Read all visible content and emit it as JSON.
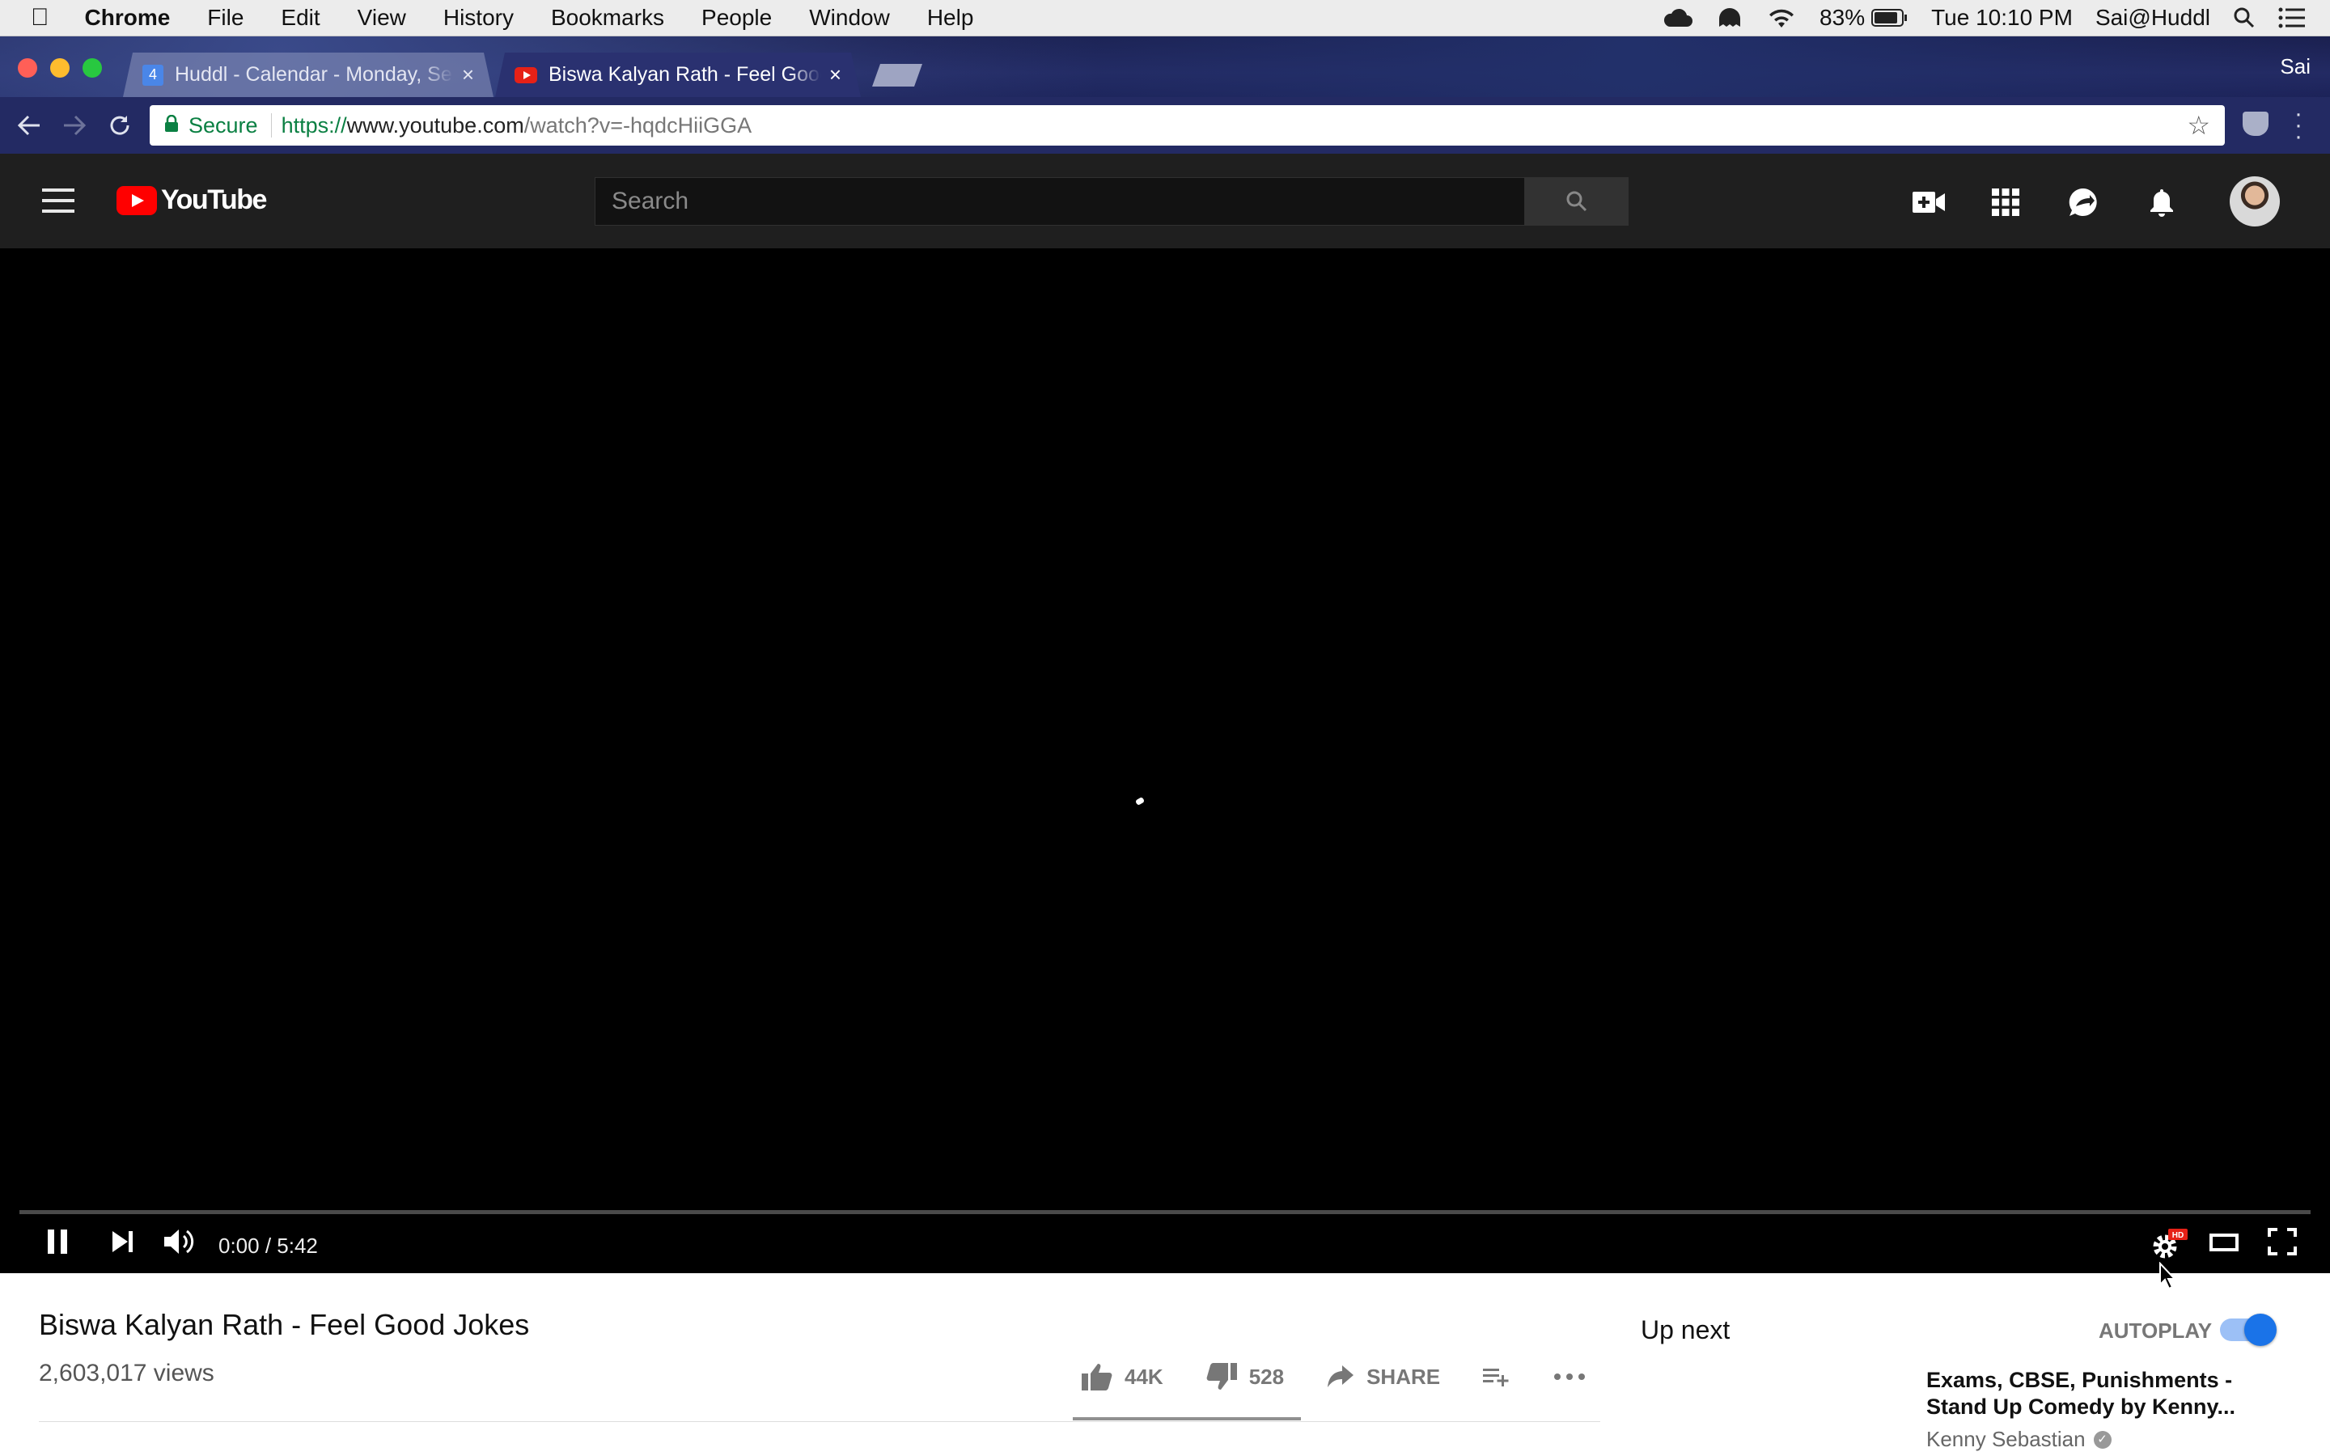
{
  "menubar": {
    "app": "Chrome",
    "items": [
      "File",
      "Edit",
      "View",
      "History",
      "Bookmarks",
      "People",
      "Window",
      "Help"
    ],
    "battery": "83%",
    "clock": "Tue 10:10 PM",
    "user": "Sai@Huddl"
  },
  "browser": {
    "tabs": [
      {
        "title": "Huddl - Calendar - Monday, Se",
        "favicon": "calendar-icon",
        "favicon_text": "4"
      },
      {
        "title": "Biswa Kalyan Rath - Feel Good Jokes",
        "favicon": "youtube-icon"
      }
    ],
    "tab_close": "×",
    "profile": "Sai",
    "secure_label": "Secure",
    "url": {
      "scheme": "https://",
      "host": "www.youtube.com",
      "path": "/watch?v=-hqdcHiiGGA"
    }
  },
  "youtube": {
    "logo_text": "YouTube",
    "search_placeholder": "Search"
  },
  "player": {
    "time": "0:00 / 5:42",
    "progress": 0,
    "hd_badge": "HD"
  },
  "video": {
    "title": "Biswa Kalyan Rath - Feel Good Jokes",
    "views": "2,603,017 views",
    "likes": "44K",
    "dislikes": "528",
    "share_label": "SHARE"
  },
  "sidebar": {
    "up_next": "Up next",
    "autoplay": "AUTOPLAY",
    "autoplay_on": true,
    "next_title": "Exams, CBSE, Punishments - Stand Up Comedy by Kenny...",
    "next_channel": "Kenny Sebastian"
  },
  "colors": {
    "youtube_red": "#ff0000",
    "secure_green": "#0b8043",
    "toggle_blue": "#1a73e8"
  }
}
